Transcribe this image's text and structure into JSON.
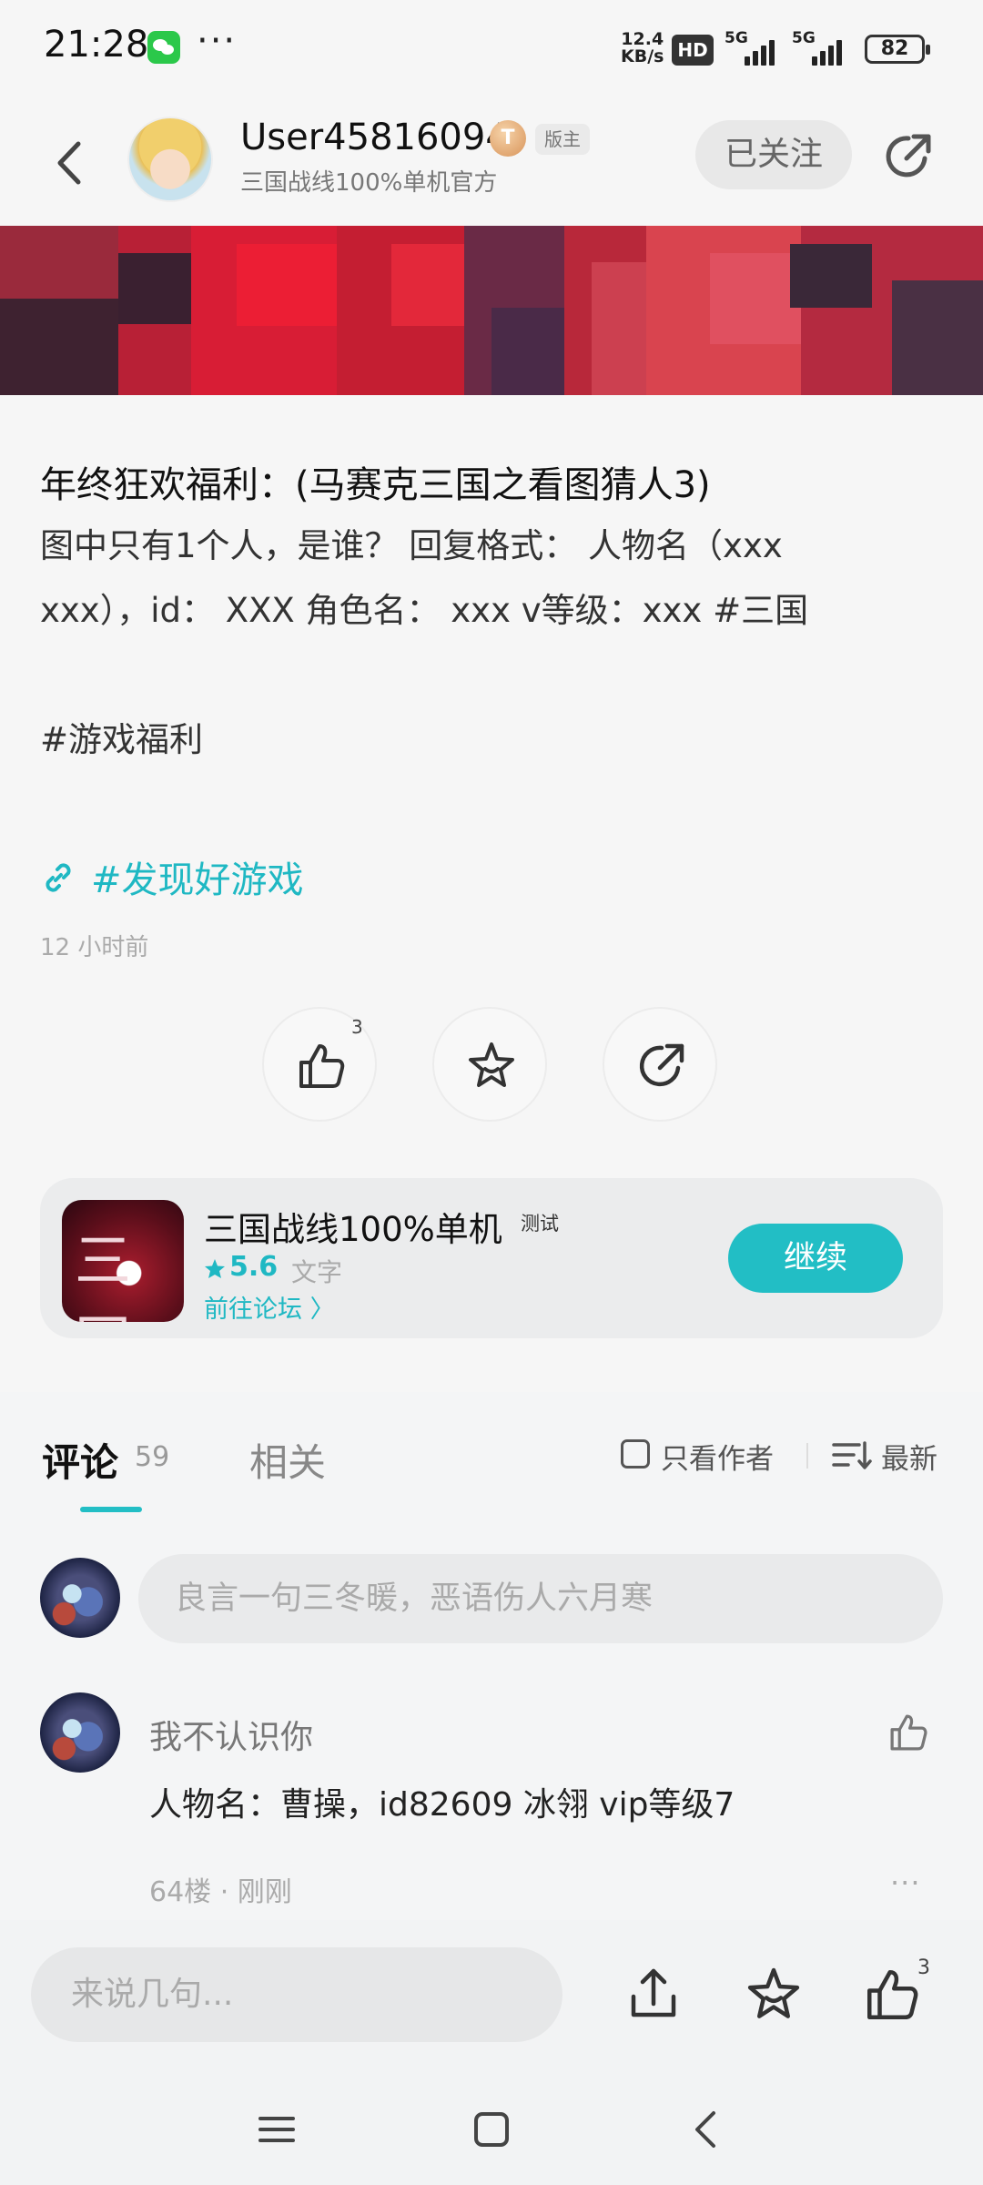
{
  "status_bar": {
    "time": "21:28",
    "dots": "···",
    "net_speed_value": "12.4",
    "net_speed_unit": "KB/s",
    "hd_label": "HD",
    "signal1_label": "5G",
    "signal2_label": "5G",
    "battery": "82"
  },
  "header": {
    "username": "User45816094",
    "level_badge": "T",
    "role_badge": "版主",
    "subtitle": "三国战线100%单机官方",
    "follow_label": "已关注"
  },
  "post": {
    "title": "年终狂欢福利：(马赛克三国之看图猜人3)",
    "body_lines": [
      "图中只有1个人，是谁？ 回复格式： 人物名（xxx",
      "xxx），id： XXX 角色名： xxx v等级：xxx #三国",
      "",
      "#游戏福利"
    ],
    "topic": "#发现好游戏",
    "time": "12 小时前",
    "like_count": "3"
  },
  "game_card": {
    "name": "三国战线100%单机",
    "tag": "测试",
    "rating": "5.6",
    "genre": "文字",
    "forum_link": "前往论坛 〉",
    "continue_label": "继续",
    "icon_glyph": "三国"
  },
  "comments": {
    "tab_comments": "评论",
    "tab_comments_count": "59",
    "tab_related": "相关",
    "author_only_label": "只看作者",
    "sort_label": "最新",
    "input_placeholder": "良言一句三冬暖，恶语伤人六月寒",
    "items": [
      {
        "name": "我不认识你",
        "text": "人物名：曹操，id82609 冰翎 vip等级7",
        "meta": "64楼 · 刚刚",
        "more": "···"
      }
    ]
  },
  "bottom_bar": {
    "input_placeholder": "来说几句...",
    "like_count": "3"
  },
  "colors": {
    "accent": "#22bec5",
    "link": "#1fb8c3",
    "background": "#f6f6f6"
  },
  "icons": [
    "back-arrow-icon",
    "share-icon",
    "link-icon",
    "like-icon",
    "star-icon",
    "upload-icon",
    "menu-icon",
    "home-square-icon",
    "nav-back-icon",
    "sort-icon"
  ]
}
